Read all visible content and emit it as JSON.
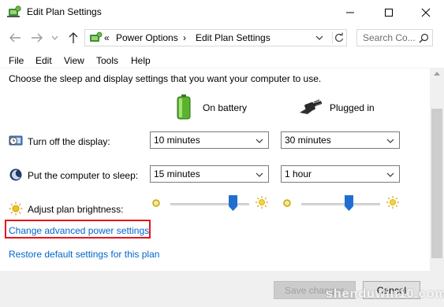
{
  "window": {
    "title": "Edit Plan Settings"
  },
  "address": {
    "prefix": "«",
    "crumb1": "Power Options",
    "separator": "›",
    "crumb2": "Edit Plan Settings",
    "search_placeholder": "Search Co..."
  },
  "menu": {
    "items": [
      "File",
      "Edit",
      "View",
      "Tools",
      "Help"
    ]
  },
  "content": {
    "intro": "Choose the sleep and display settings that you want your computer to use.",
    "col_battery": "On battery",
    "col_plugged": "Plugged in",
    "rows": [
      {
        "label": "Turn off the display:",
        "battery": "10 minutes",
        "plugged": "30 minutes"
      },
      {
        "label": "Put the computer to sleep:",
        "battery": "15 minutes",
        "plugged": "1 hour"
      }
    ],
    "brightness_label": "Adjust plan brightness:",
    "brightness": {
      "battery_level": 0.83,
      "plugged_level": 0.62
    },
    "link_advanced": "Change advanced power settings",
    "link_restore": "Restore default settings for this plan"
  },
  "footer": {
    "save": "Save changes",
    "cancel": "Cancel"
  },
  "watermark": "shenduwin10.com",
  "colors": {
    "link": "#0066cc",
    "highlight": "#e8141b",
    "slider_handle": "#1f6fd1"
  }
}
